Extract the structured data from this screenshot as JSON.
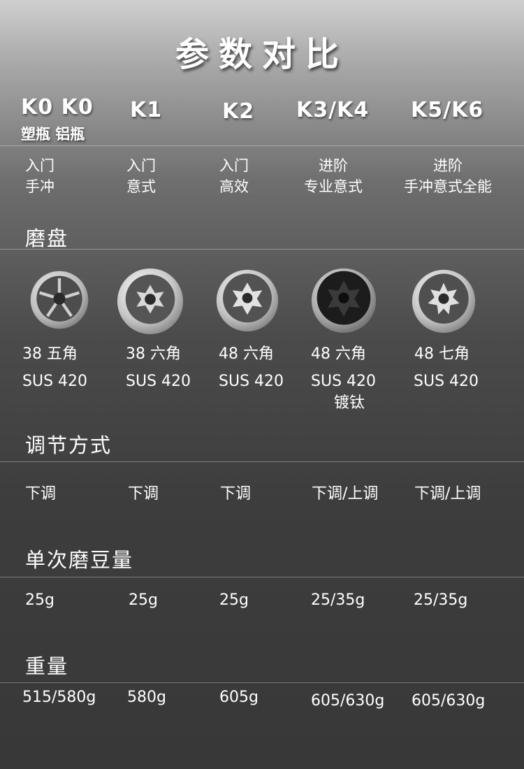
{
  "title": "参数对比",
  "models": [
    {
      "name": "K0 K0",
      "sub": "塑瓶 铝瓶"
    },
    {
      "name": "K1"
    },
    {
      "name": "K2"
    },
    {
      "name": "K3/K4"
    },
    {
      "name": "K5/K6"
    }
  ],
  "levels": [
    {
      "tier": "入门",
      "use": "手冲"
    },
    {
      "tier": "入门",
      "use": "意式"
    },
    {
      "tier": "入门",
      "use": "高效"
    },
    {
      "tier": "进阶",
      "use": "专业意式"
    },
    {
      "tier": "进阶",
      "use": "手冲意式全能"
    }
  ],
  "sections": {
    "burr": "磨盘",
    "adjust": "调节方式",
    "capacity": "单次磨豆量",
    "weight": "重量"
  },
  "burrs": [
    {
      "spec": "38 五角",
      "material": "SUS 420",
      "icon": "burr-5-point-icon"
    },
    {
      "spec": "38 六角",
      "material": "SUS 420",
      "icon": "burr-6-point-icon"
    },
    {
      "spec": "48 六角",
      "material": "SUS 420",
      "icon": "burr-6-point-icon"
    },
    {
      "spec": "48 六角",
      "material": "SUS 420",
      "coating": "镀钛",
      "icon": "burr-titanium-icon"
    },
    {
      "spec": "48 七角",
      "material": "SUS 420",
      "icon": "burr-7-point-icon"
    }
  ],
  "adjust": [
    "下调",
    "下调",
    "下调",
    "下调/上调",
    "下调/上调"
  ],
  "capacity": [
    "25g",
    "25g",
    "25g",
    "25/35g",
    "25/35g"
  ],
  "weight": [
    "515/580g",
    "580g",
    "605g",
    "605/630g",
    "605/630g"
  ],
  "colors": {
    "text": "#ffffff",
    "background_top": "#cfcfcf",
    "background_bottom": "#383838"
  }
}
